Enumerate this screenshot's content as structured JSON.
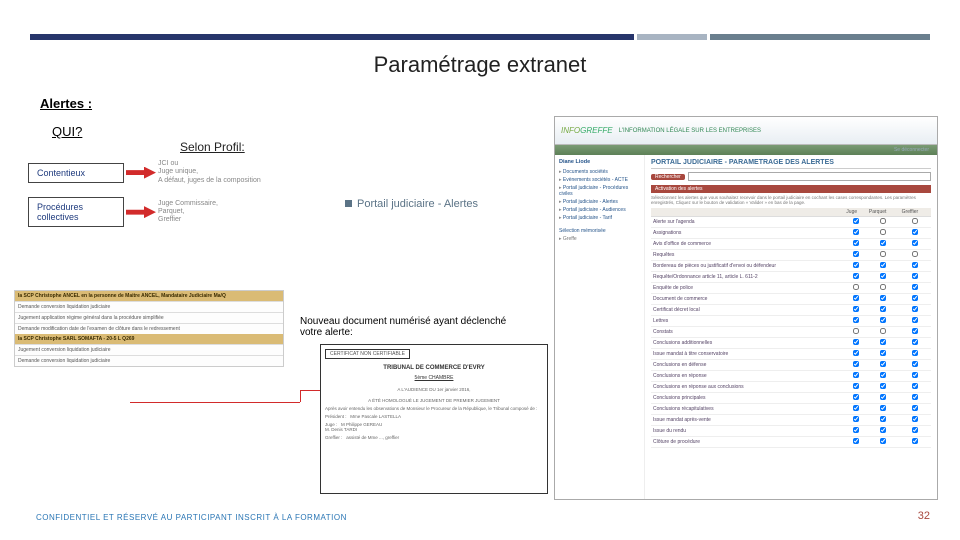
{
  "slide": {
    "title": "Paramétrage extranet",
    "heading_alerts": "Alertes :",
    "heading_qui": "QUI?",
    "heading_profil": "Selon Profil:",
    "footer": "CONFIDENTIEL ET RÉSERVÉ AU PARTICIPANT INSCRIT À LA FORMATION",
    "pagenum": "32"
  },
  "flow": {
    "left1": "Contentieux",
    "right1": "JCI ou\nJuge unique,\nA défaut, juges de la composition",
    "left2": "Procédures collectives",
    "right2": "Juge Commissaire,\nParquet,\nGreffier"
  },
  "portal_label": "Portail judiciaire - Alertes",
  "screen_left": {
    "hdr1": "la SCP Christophe ANCEL en la personne de Maitre ANCEL, Mandataire Judiciaire Ma/Q",
    "l1": "Demande conversion liquidation judiciaire",
    "l2": "Jugement application régime général dans la procédure simplifiée",
    "l3": "Demande modification date de l'examen de clôture dans le redressement",
    "hdr2": "la SCP Christophe SARL SOMAFTA - 20-5 L Q269",
    "l4": "Jugement conversion liquidation judiciaire",
    "l5": "Demande conversion liquidation judiciaire"
  },
  "mid_caption": "Nouveau document numérisé ayant déclenché votre alerte:",
  "doc": {
    "stamp": "CERTIFICAT NON CERTIFIABLE",
    "tribunal": "TRIBUNAL DE COMMERCE D'EVRY",
    "chamber": "5ème CHAMBRE",
    "audience": "A L'AUDIENCE DU 1er janvier 2016,",
    "assist": "A ÉTÉ HOMOLOGUÉ LE JUGEMENT DE PREMIER JUGEMENT",
    "troiscomp": "Après avoir entendu les observations de Monsieur le Procureur de la République, le Tribunal composé de :",
    "president": "Président :",
    "president_v": "Mme Pascale LASTELLA",
    "juge": "Juge :",
    "juge_v": "M Philippe GEREAU\nM. Denis TARDI",
    "greffier": "Greffier :",
    "greffier_v": "assisté de Mme ..., greffier"
  },
  "portal": {
    "logo": "INFOGREFFE",
    "tagline": "L'INFORMATION LÉGALE SUR LES ENTREPRISES",
    "strip_user": "Diane Liode",
    "logout": "Se déconnecter",
    "main_title": "PORTAIL JUDICIAIRE - PARAMETRAGE DES ALERTES",
    "sidebar_a": [
      "Documents sociétés",
      "Evènements sociétés - ACTE",
      "Portail judiciaire - Procédures civiles",
      "Portail judiciaire - Alertes",
      "Portail judiciaire - Audiences",
      "Portail judiciaire - Tarif"
    ],
    "sidebar_b_title": "Sélection mémorisée",
    "sidebar_b": [
      "Greffe"
    ],
    "search_label": "Rechercher",
    "search_placeholder": "",
    "section_hdr": "Activation des alertes",
    "note": "Sélectionnez les alertes que vous souhaitez recevoir dans le portail judiciaire en cochant les cases correspondantes. Les paramètres enregistrés, Cliquez sur le bouton de validation « Valider » en bas de la page.",
    "col1": "",
    "col2": "Juge",
    "col3": "Parquet",
    "col4": "Greffier",
    "rows": [
      "Alerte sur l'agenda",
      "Assignations",
      "Avis d'office de commerce",
      "Requêtes",
      "Bordereau de pièces ou justificatif d'envoi ou défendeur",
      "Requête/Ordonnance article 11, article L. 611-2",
      "Enquête de police",
      "Document de commerce",
      "Certificat décret local",
      "Lettres",
      "Constats",
      "Conclusions additionnelles",
      "Issue mandat à titre conservatoire",
      "Conclusions en défense",
      "Conclusions en réponse",
      "Conclusions en réponse aux conclusions",
      "Conclusions principales",
      "Conclusions récapitulatives",
      "Issue mandat après-vente",
      "Issue du rendu",
      "Clôture de procédure"
    ],
    "checks": [
      [
        true,
        false,
        false
      ],
      [
        true,
        false,
        true
      ],
      [
        true,
        true,
        true
      ],
      [
        true,
        false,
        false
      ],
      [
        true,
        true,
        true
      ],
      [
        true,
        true,
        true
      ],
      [
        false,
        false,
        true
      ],
      [
        true,
        true,
        true
      ],
      [
        true,
        true,
        true
      ],
      [
        true,
        true,
        true
      ],
      [
        false,
        false,
        true
      ],
      [
        true,
        true,
        true
      ],
      [
        true,
        true,
        true
      ],
      [
        true,
        true,
        true
      ],
      [
        true,
        true,
        true
      ],
      [
        true,
        true,
        true
      ],
      [
        true,
        true,
        true
      ],
      [
        true,
        true,
        true
      ],
      [
        true,
        true,
        true
      ],
      [
        true,
        true,
        true
      ],
      [
        true,
        true,
        true
      ]
    ]
  }
}
